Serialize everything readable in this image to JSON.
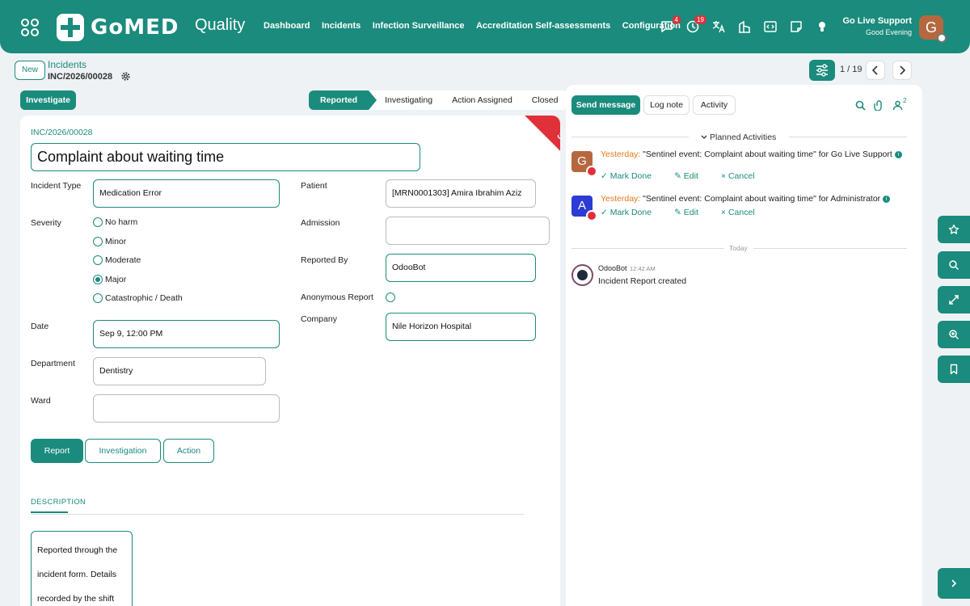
{
  "topbar": {
    "logo_text": "GoMED",
    "app_name": "Quality",
    "menu": [
      "Dashboard",
      "Incidents",
      "Infection Surveillance",
      "Accreditation Self-assessments",
      "Configuration"
    ],
    "messages_badge": "4",
    "activities_badge": "19",
    "user_name": "Go Live Support",
    "greeting": "Good Evening",
    "avatar_letter": "G"
  },
  "control": {
    "new_label": "New",
    "breadcrumb": "Incidents",
    "record_ref": "INC/2026/00028",
    "pager": "1 / 19"
  },
  "statusbar": {
    "investigate_label": "Investigate",
    "stages": [
      "Reported",
      "Investigating",
      "Action Assigned",
      "Closed"
    ]
  },
  "form": {
    "ribbon": "SENTINEL",
    "ref": "INC/2026/00028",
    "title": "Complaint about waiting time",
    "labels": {
      "incident_type": "Incident Type",
      "severity": "Severity",
      "date": "Date",
      "department": "Department",
      "ward": "Ward",
      "patient": "Patient",
      "admission": "Admission",
      "reported_by": "Reported By",
      "anonymous": "Anonymous Report",
      "company": "Company"
    },
    "values": {
      "incident_type": "Medication Error",
      "date": "Sep 9, 12:00 PM",
      "department": "Dentistry",
      "ward": "",
      "patient": "[MRN0001303] Amira Ibrahim Aziz",
      "admission": "",
      "reported_by": "OdooBot",
      "company": "Nile Horizon Hospital"
    },
    "severity_options": [
      "No harm",
      "Minor",
      "Moderate",
      "Major",
      "Catastrophic / Death"
    ],
    "severity_selected": "Major",
    "tabs": [
      "Report",
      "Investigation",
      "Action"
    ],
    "description_tab": "DESCRIPTION",
    "description_text": "Reported through the incident form. Details recorded by the shift"
  },
  "chatter": {
    "send_message": "Send message",
    "log_note": "Log note",
    "activity": "Activity",
    "followers_count": "2",
    "planned_activities": "Planned Activities",
    "activities": [
      {
        "avatar": "G",
        "avatar_color": "#b5683f",
        "when": "Yesterday:",
        "summary": "\"Sentinel event: Complaint about waiting time\"",
        "for_text": "for Go Live Support"
      },
      {
        "avatar": "A",
        "avatar_color": "#2d3bd6",
        "when": "Yesterday:",
        "summary": "\"Sentinel event: Complaint about waiting time\"",
        "for_text": "for Administrator"
      }
    ],
    "mark_done": "Mark Done",
    "edit": "Edit",
    "cancel": "Cancel",
    "today": "Today",
    "message": {
      "author": "OdooBot",
      "time": "12:42 AM",
      "body": "Incident Report created"
    }
  },
  "colors": {
    "brand": "#1a8b7c",
    "ribbon": "#e0303a",
    "overdue": "#e07a1a"
  }
}
